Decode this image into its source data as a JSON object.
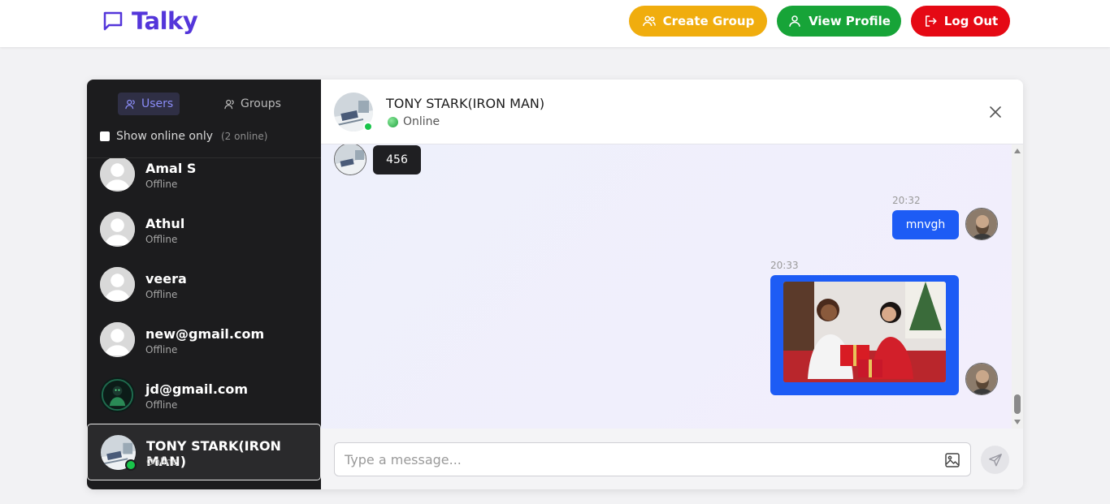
{
  "header": {
    "brand": "Talky",
    "buttons": {
      "create_group": "Create Group",
      "view_profile": "View Profile",
      "log_out": "Log Out"
    }
  },
  "sidebar": {
    "tabs": {
      "users": "Users",
      "groups": "Groups"
    },
    "online_filter": {
      "label": "Show online only",
      "count": "(2 online)"
    },
    "users": [
      {
        "name": "Amal S",
        "status": "Offline"
      },
      {
        "name": "Athul",
        "status": "Offline"
      },
      {
        "name": "veera",
        "status": "Offline"
      },
      {
        "name": "new@gmail.com",
        "status": "Offline"
      },
      {
        "name": "jd@gmail.com",
        "status": "Offline"
      },
      {
        "name": "TONY STARK(IRON MAN)",
        "status": "Online"
      }
    ]
  },
  "chat": {
    "header": {
      "name": "TONY STARK(IRON MAN)",
      "status": "Online"
    },
    "messages": [
      {
        "direction": "in",
        "text": "456"
      },
      {
        "direction": "out",
        "time": "20:32",
        "text": "mnvgh"
      },
      {
        "direction": "out",
        "time": "20:33",
        "type": "image"
      }
    ],
    "composer": {
      "placeholder": "Type a message..."
    }
  },
  "colors": {
    "brand": "#5436da",
    "create_group": "#f0ad0e",
    "view_profile": "#17a438",
    "log_out": "#e50914",
    "outgoing_bubble": "#1d5cf5",
    "incoming_bubble": "#1f1f22",
    "online": "#19c44a"
  }
}
